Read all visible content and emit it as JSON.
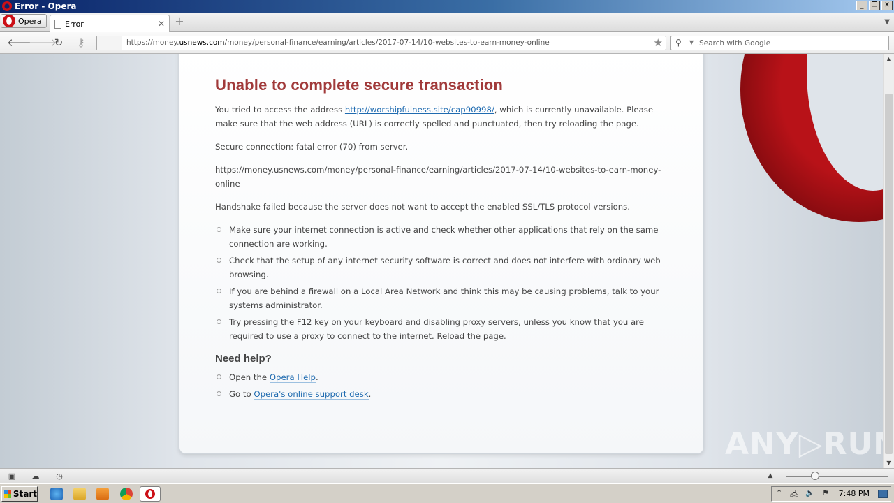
{
  "window": {
    "title": "Error - Opera"
  },
  "tabbar": {
    "menu_label": "Opera",
    "tab_title": "Error"
  },
  "address": {
    "url_prefix": "https://money.",
    "url_domain": "usnews.com",
    "url_path": "/money/personal-finance/earning/articles/2017-07-14/10-websites-to-earn-money-online"
  },
  "search": {
    "placeholder": "Search with Google"
  },
  "error": {
    "title": "Unable to complete secure transaction",
    "intro_before": "You tried to access the address ",
    "intro_link": "http://worshipfulness.site/cap90998/",
    "intro_after": ", which is currently unavailable. Please make sure that the web address (URL) is correctly spelled and punctuated, then try reloading the page.",
    "secure_msg": "Secure connection: fatal error (70) from server.",
    "url_line": "https://money.usnews.com/money/personal-finance/earning/articles/2017-07-14/10-websites-to-earn-money-online",
    "handshake": "Handshake failed because the server does not want to accept the enabled SSL/TLS protocol versions.",
    "tips": [
      "Make sure your internet connection is active and check whether other applications that rely on the same connection are working.",
      "Check that the setup of any internet security software is correct and does not interfere with ordinary web browsing.",
      "If you are behind a firewall on a Local Area Network and think this may be causing problems, talk to your systems administrator.",
      "Try pressing the F12 key on your keyboard and disabling proxy servers, unless you know that you are required to use a proxy to connect to the internet. Reload the page."
    ],
    "help_heading": "Need help?",
    "help1_before": "Open the ",
    "help1_link": "Opera Help",
    "help1_after": ".",
    "help2_before": "Go to ",
    "help2_link": "Opera's online support desk",
    "help2_after": "."
  },
  "watermark": "ANY▷RUN",
  "taskbar": {
    "start_label": "Start",
    "clock": "7:48 PM"
  },
  "colors": {
    "error_title": "#a13a3a",
    "link": "#1f6bb0",
    "opera_red": "#cc0f16"
  },
  "icons": [
    "opera-logo-icon",
    "page-icon",
    "close-icon",
    "plus-icon",
    "back-icon",
    "forward-icon",
    "reload-icon",
    "key-icon",
    "star-icon",
    "search-icon",
    "windows-flag-icon"
  ]
}
